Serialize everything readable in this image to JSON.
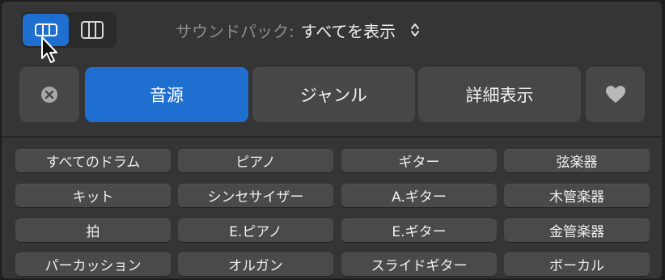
{
  "view_switcher": {
    "left_icon": "rows-icon",
    "right_icon": "columns-icon",
    "selected": "left"
  },
  "sound_pack": {
    "label": "サウンドパック:",
    "value": "すべてを表示"
  },
  "tabs": [
    {
      "label": "音源",
      "active": true
    },
    {
      "label": "ジャンル",
      "active": false
    },
    {
      "label": "詳細表示",
      "active": false
    }
  ],
  "clear_icon": "x-circle-icon",
  "favorite_icon": "heart-icon",
  "categories": [
    [
      "すべてのドラム",
      "ピアノ",
      "ギター",
      "弦楽器"
    ],
    [
      "キット",
      "シンセサイザー",
      "A.ギター",
      "木管楽器"
    ],
    [
      "拍",
      "E.ピアノ",
      "E.ギター",
      "金管楽器"
    ],
    [
      "パーカッション",
      "オルガン",
      "スライドギター",
      "ボーカル"
    ]
  ],
  "colors": {
    "accent": "#1f6fd1",
    "panel": "#353535",
    "button": "#474747"
  }
}
